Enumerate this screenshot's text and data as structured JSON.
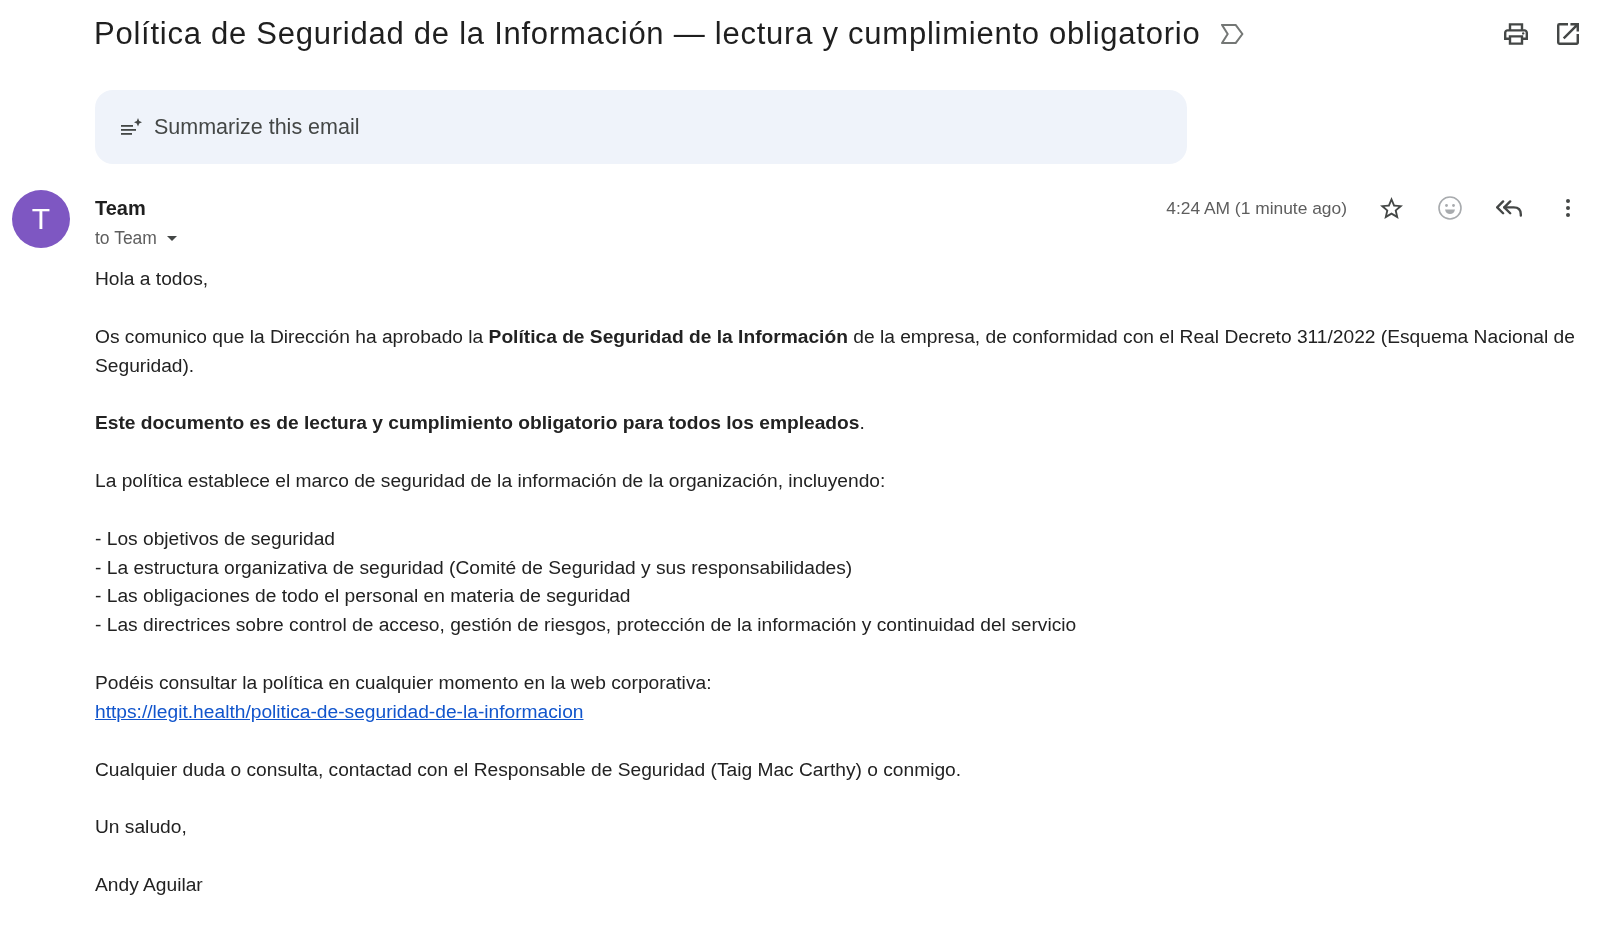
{
  "subject": {
    "title": "Política de Seguridad de la Información — lectura y cumplimiento obligatorio"
  },
  "summarize": {
    "label": "Summarize this email"
  },
  "message": {
    "avatar_letter": "T",
    "sender": "Team",
    "recipients": "to Team",
    "time": "4:24 AM (1 minute ago)",
    "starred": false,
    "body": [
      {
        "kind": "paragraph",
        "text": "Hola a todos,"
      },
      {
        "kind": "paragraph",
        "text": "Os comunico que la Dirección ha aprobado la **Política de Seguridad de la Información** de la empresa, de conformidad con el Real Decreto 311/2022 (Esquema Nacional de Seguridad)."
      },
      {
        "kind": "paragraph",
        "text": "**Este documento es de lectura y cumplimiento obligatorio para todos los empleados**."
      },
      {
        "kind": "paragraph",
        "text": "La política establece el marco de seguridad de la información de la organización, incluyendo:"
      },
      {
        "kind": "list",
        "items": [
          "- Los objetivos de seguridad",
          "- La estructura organizativa de seguridad (Comité de Seguridad y sus responsabilidades)",
          "- Las obligaciones de todo el personal en materia de seguridad",
          "- Las directrices sobre control de acceso, gestión de riesgos, protección de la información y continuidad del servicio"
        ]
      },
      {
        "kind": "link",
        "text": "Podéis consultar la política en cualquier momento en la web corporativa:",
        "link": "https://legit.health/politica-de-seguridad-de-la-informacion"
      },
      {
        "kind": "paragraph",
        "text": "Cualquier duda o consulta, contactad con el Responsable de Seguridad (Taig Mac Carthy) o conmigo."
      },
      {
        "kind": "paragraph",
        "text": "Un saludo,"
      },
      {
        "kind": "paragraph",
        "text": "Andy Aguilar"
      }
    ]
  }
}
